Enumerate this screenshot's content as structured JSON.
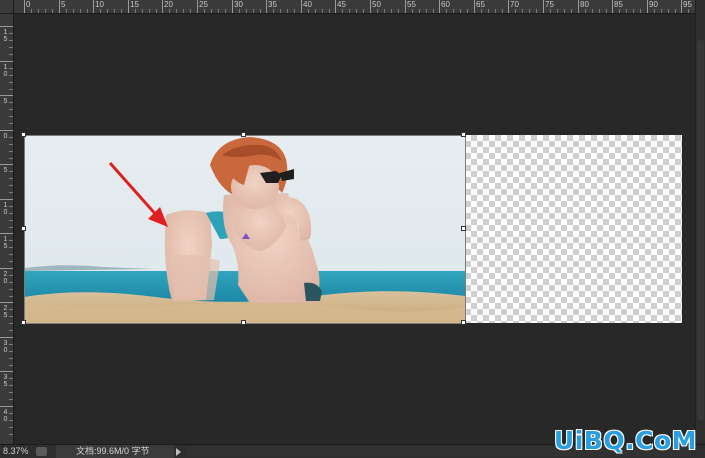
{
  "rulers": {
    "top_labels": [
      "0",
      "5",
      "10",
      "15",
      "20",
      "25",
      "30",
      "35",
      "40",
      "45",
      "50",
      "55",
      "60",
      "65",
      "70",
      "75",
      "80",
      "85",
      "90",
      "95"
    ],
    "left_labels": [
      "1\n5",
      "1\n0",
      "5",
      "0",
      "5",
      "1\n0",
      "1\n5",
      "2\n0",
      "2\n5",
      "3\n0",
      "3\n5",
      "4\n0"
    ]
  },
  "status": {
    "zoom": "8.37%",
    "doc": "文档:99.6M/0 字节"
  },
  "watermark": "UiBQ.CoM",
  "colors": {
    "workspace": "#282828",
    "ruler": "#3a3a3a",
    "arrow": "#e02020",
    "watermark": "#2a9ee3"
  }
}
